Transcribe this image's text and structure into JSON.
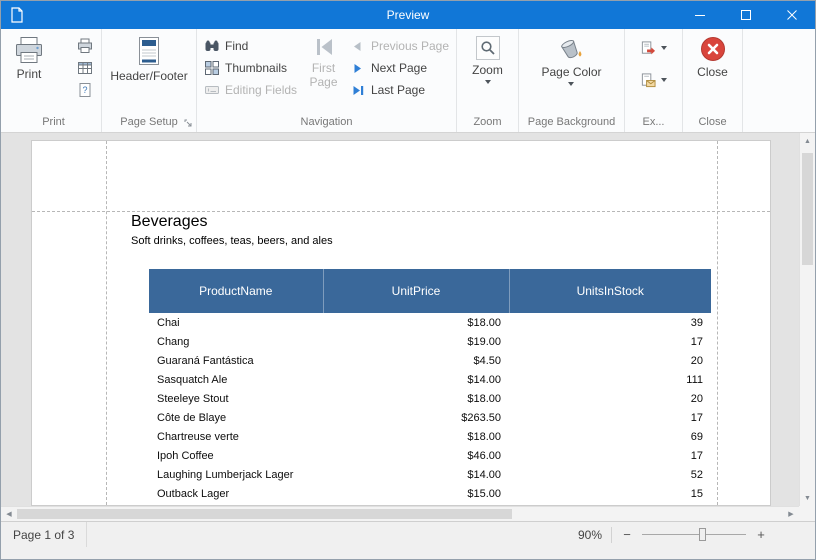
{
  "window": {
    "title": "Preview"
  },
  "ribbon": {
    "print_group": {
      "caption": "Print",
      "print": "Print"
    },
    "page_setup_group": {
      "caption": "Page Setup",
      "header_footer": "Header/Footer"
    },
    "navigation_group": {
      "caption": "Navigation",
      "find": "Find",
      "thumbnails": "Thumbnails",
      "editing_fields": "Editing Fields",
      "first_page": "First Page",
      "previous_page": "Previous Page",
      "next_page": "Next Page",
      "last_page": "Last Page"
    },
    "zoom_group": {
      "caption": "Zoom",
      "zoom": "Zoom"
    },
    "page_background_group": {
      "caption": "Page Background",
      "page_color": "Page Color"
    },
    "export_group": {
      "caption": "Ex..."
    },
    "close_group": {
      "caption": "Close",
      "close": "Close"
    }
  },
  "document": {
    "heading": "Beverages",
    "subtitle": "Soft drinks, coffees, teas, beers, and ales",
    "table": {
      "columns": [
        "ProductName",
        "UnitPrice",
        "UnitsInStock"
      ],
      "rows": [
        [
          "Chai",
          "$18.00",
          "39"
        ],
        [
          "Chang",
          "$19.00",
          "17"
        ],
        [
          "Guaraná Fantástica",
          "$4.50",
          "20"
        ],
        [
          "Sasquatch Ale",
          "$14.00",
          "111"
        ],
        [
          "Steeleye Stout",
          "$18.00",
          "20"
        ],
        [
          "Côte de Blaye",
          "$263.50",
          "17"
        ],
        [
          "Chartreuse verte",
          "$18.00",
          "69"
        ],
        [
          "Ipoh Coffee",
          "$46.00",
          "17"
        ],
        [
          "Laughing Lumberjack Lager",
          "$14.00",
          "52"
        ],
        [
          "Outback Lager",
          "$15.00",
          "15"
        ]
      ]
    }
  },
  "statusbar": {
    "page_info": "Page 1 of 3",
    "zoom_value": "90%",
    "zoom_out_label": "−",
    "zoom_in_label": "+"
  },
  "colors": {
    "titlebar_blue": "#1177d7",
    "table_header_blue": "#3a689a",
    "accent_blue": "#2f7fd6",
    "close_red": "#d9453c"
  }
}
